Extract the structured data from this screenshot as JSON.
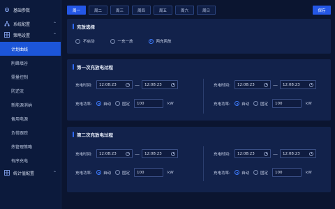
{
  "sidebar": {
    "groups": [
      {
        "label": "基础参数"
      },
      {
        "label": "系统配置"
      },
      {
        "label": "策略设置"
      },
      {
        "label": "统计值配置"
      }
    ],
    "items": [
      {
        "label": "计划曲线"
      },
      {
        "label": "削峰填谷"
      },
      {
        "label": "需量控制"
      },
      {
        "label": "防逆流"
      },
      {
        "label": "新能源消纳"
      },
      {
        "label": "备用电源"
      },
      {
        "label": "负荷跟踪"
      },
      {
        "label": "热管理策略"
      },
      {
        "label": "有序充电"
      }
    ]
  },
  "tabs": [
    "周一",
    "周二",
    "周三",
    "周四",
    "周五",
    "周六",
    "周日"
  ],
  "save_label": "保存",
  "mode_panel": {
    "title": "充放选择",
    "options": [
      "不启动",
      "一充一放",
      "两充两放"
    ],
    "selected": "两充两放"
  },
  "process1": {
    "title": "第一次充放电过程",
    "left": {
      "time_label": "充电时间:",
      "start": "12:08:23",
      "end": "12:08:23",
      "power_label": "充电功率:",
      "auto_label": "自动",
      "fixed_label": "固定",
      "value": "100",
      "unit": "kW"
    },
    "right": {
      "time_label": "充电时间:",
      "start": "12:08:23",
      "end": "12:08:23",
      "power_label": "充电功率:",
      "auto_label": "自动",
      "fixed_label": "固定",
      "value": "100",
      "unit": "kW"
    }
  },
  "process2": {
    "title": "第二次充放电过程",
    "left": {
      "time_label": "充电时间:",
      "start": "12:08:23",
      "end": "12:08:23",
      "power_label": "充电功率:",
      "auto_label": "自动",
      "fixed_label": "固定",
      "value": "100",
      "unit": "kW"
    },
    "right": {
      "time_label": "充电时间:",
      "start": "12:08:23",
      "end": "12:08:23",
      "power_label": "充电功率:",
      "auto_label": "自动",
      "fixed_label": "固定",
      "value": "100",
      "unit": "kW"
    }
  },
  "colors": {
    "accent": "#2457e6",
    "background": "#0b1530",
    "panel": "#12224b"
  }
}
